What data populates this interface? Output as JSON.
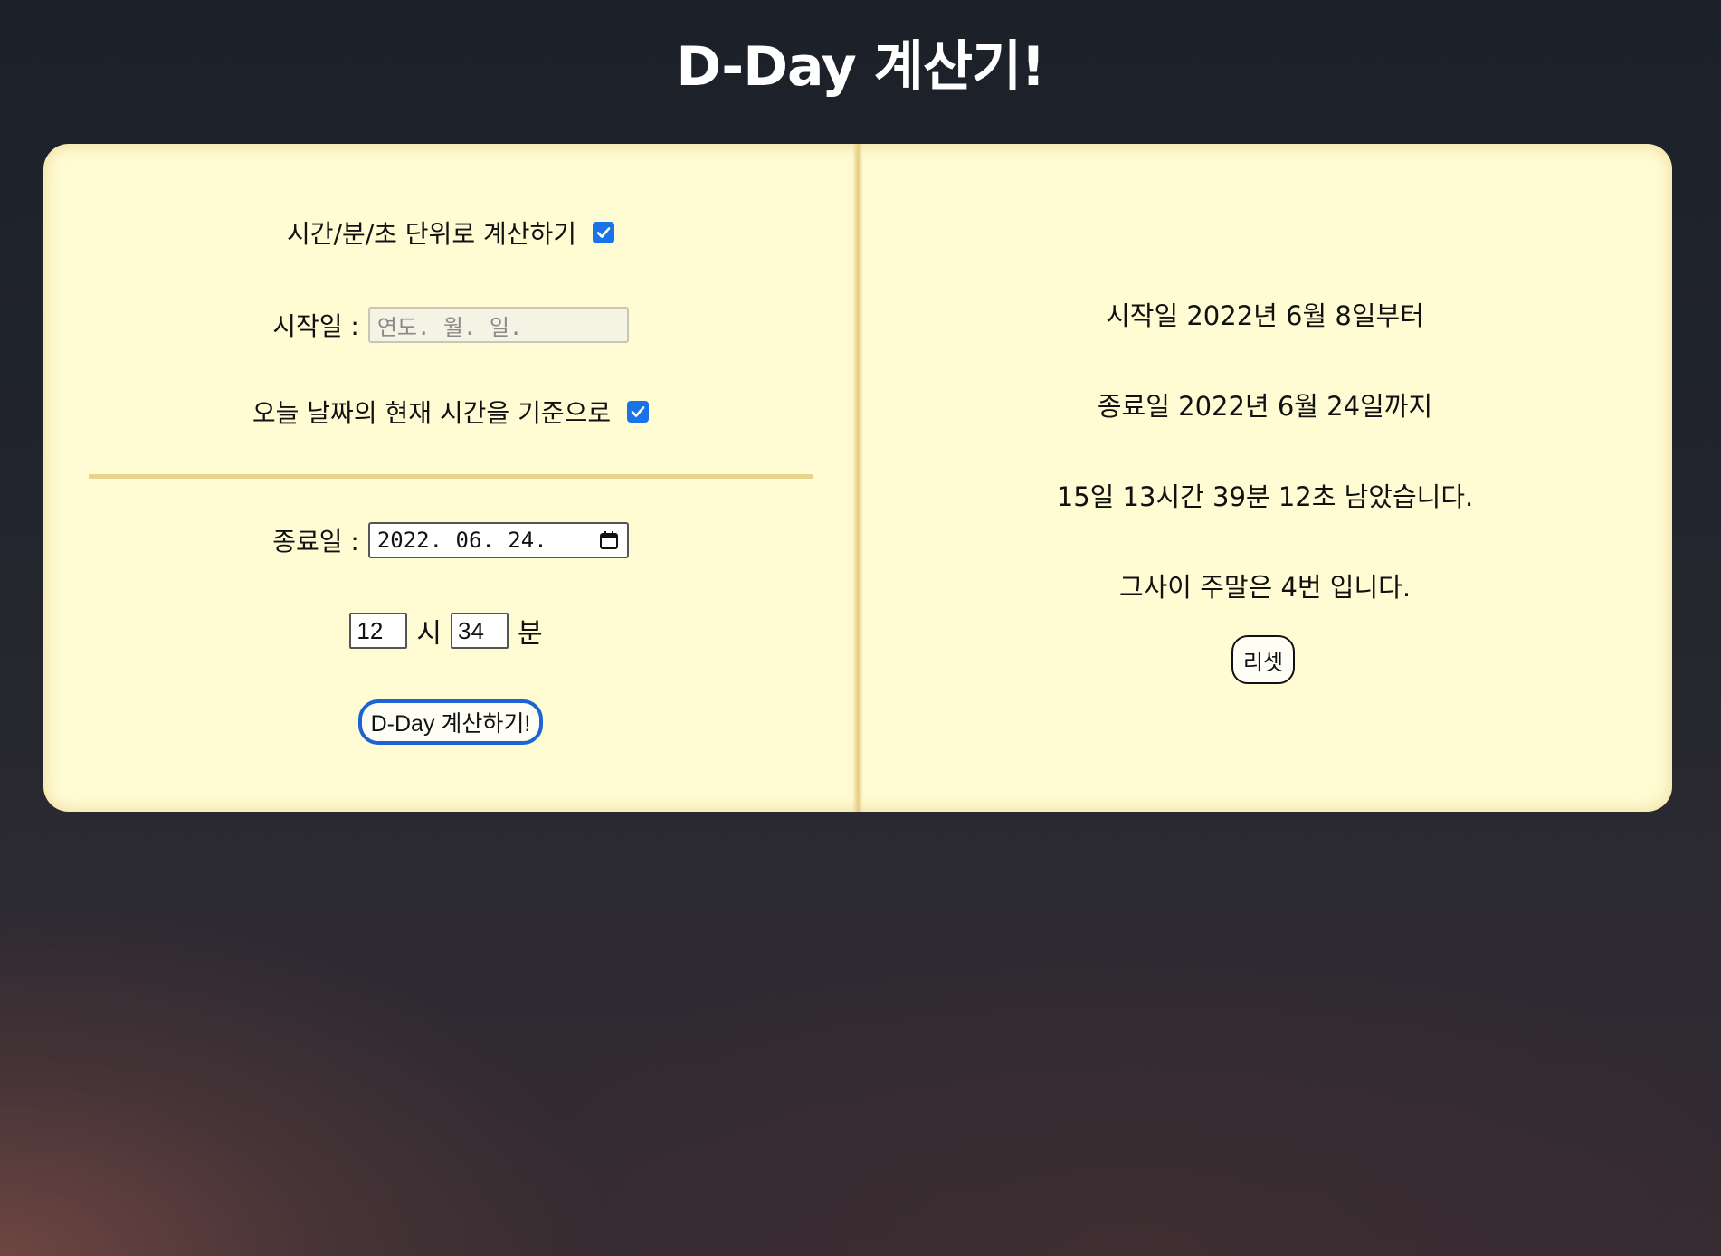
{
  "page": {
    "title": "D-Day 계산기!"
  },
  "form": {
    "unit_option_label": "시간/분/초 단위로 계산하기",
    "unit_option_checked": true,
    "start_label": "시작일 :",
    "start_date_placeholder": "연도. 월. 일.",
    "today_option_label": "오늘 날짜의 현재 시간을 기준으로",
    "today_option_checked": true,
    "end_label": "종료일 :",
    "end_date_value": "2022. 06. 24.",
    "hour_value": "12",
    "hour_unit": "시",
    "minute_value": "34",
    "minute_unit": "분",
    "calc_button_label": "D-Day 계산하기!"
  },
  "result": {
    "start_line": "시작일 2022년 6월 8일부터",
    "end_line": "종료일 2022년 6월 24일까지",
    "remaining_line": "15일 13시간 39분 12초 남았습니다.",
    "weekend_line": "그사이 주말은 4번 입니다.",
    "reset_button_label": "리셋"
  },
  "colors": {
    "card_background": "#fffbd3",
    "accent_blue": "#1a73e8",
    "divider": "#e9d48e"
  },
  "icons": {
    "checkbox": "check-icon",
    "date_picker": "calendar-icon"
  }
}
